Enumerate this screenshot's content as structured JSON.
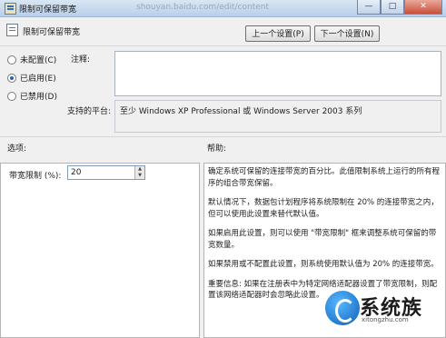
{
  "window": {
    "title": "限制可保留带宽",
    "url_text": "shouyan.baidu.com/edit/content",
    "buttons": [
      "—",
      "□",
      "✕"
    ]
  },
  "header": {
    "title": "限制可保留带宽",
    "prev_label": "上一个设置(P)",
    "next_label": "下一个设置(N)"
  },
  "state": {
    "options": [
      {
        "label": "未配置(C)",
        "checked": false
      },
      {
        "label": "已启用(E)",
        "checked": true
      },
      {
        "label": "已禁用(D)",
        "checked": false
      }
    ]
  },
  "comment": {
    "label": "注释:",
    "value": ""
  },
  "platform": {
    "label": "支持的平台:",
    "value": "至少 Windows XP Professional 或 Windows Server 2003 系列"
  },
  "options_section": {
    "label": "选项:",
    "bandwidth_label": "带宽限制 (%):",
    "bandwidth_value": "20"
  },
  "help": {
    "label": "帮助:",
    "paragraphs": [
      "确定系统可保留的连接带宽的百分比。此值限制系统上运行的所有程序的组合带宽保留。",
      "默认情况下，数据包计划程序将系统限制在 20% 的连接带宽之内，但可以使用此设置来替代默认值。",
      "如果启用此设置，则可以使用 \"带宽限制\" 框来调整系统可保留的带宽数量。",
      "如果禁用或不配置此设置，则系统使用默认值为 20% 的连接带宽。",
      "重要信息: 如果在注册表中为特定网络适配器设置了带宽限制，则配置该网络适配器时会忽略此设置。"
    ]
  },
  "watermark": {
    "text": "系统族",
    "url": "xitongzhu.com"
  }
}
